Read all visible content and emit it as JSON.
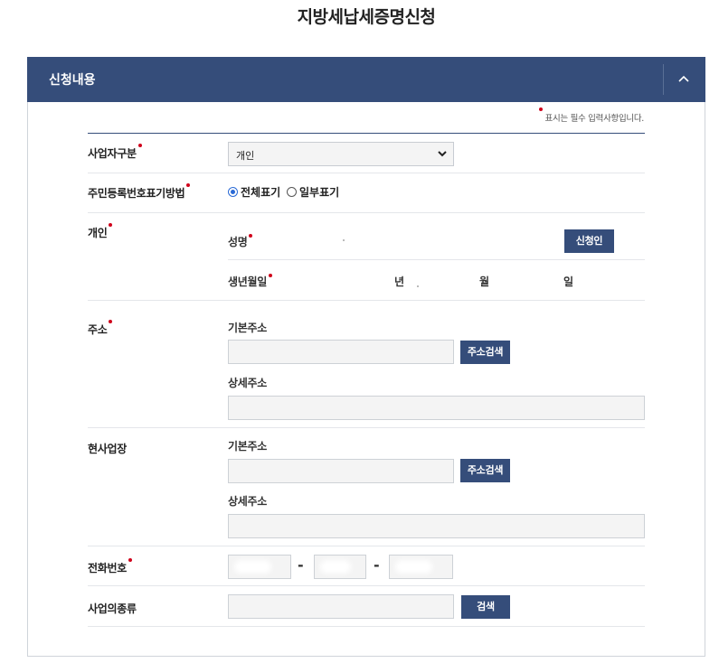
{
  "page": {
    "title": "지방세납세증명신청"
  },
  "panel": {
    "title": "신청내용",
    "collapse_icon": "chevron-up-icon"
  },
  "required_note": "표시는 필수 입력사항입니다.",
  "fields": {
    "business_type": {
      "label": "사업자구분",
      "selected": "개인"
    },
    "resident_number_display": {
      "label": "주민등록번호표기방법",
      "options": [
        "전체표기",
        "일부표기"
      ],
      "selected": "전체표기"
    },
    "individual": {
      "label": "개인",
      "name_label": "성명",
      "applicant_button": "신청인",
      "birth_label": "생년월일",
      "year_unit": "년",
      "month_unit": "월",
      "day_unit": "일"
    },
    "address": {
      "label": "주소",
      "basic_label": "기본주소",
      "search_button": "주소검색",
      "detail_label": "상세주소"
    },
    "current_business": {
      "label": "현사업장",
      "basic_label": "기본주소",
      "search_button": "주소검색",
      "detail_label": "상세주소"
    },
    "phone": {
      "label": "전화번호",
      "separator": "-"
    },
    "business_kind": {
      "label": "사업의종류",
      "search_button": "검색"
    }
  },
  "colors": {
    "header": "#354d7a",
    "required": "#d0021b",
    "input_bg": "#f4f4f4"
  }
}
